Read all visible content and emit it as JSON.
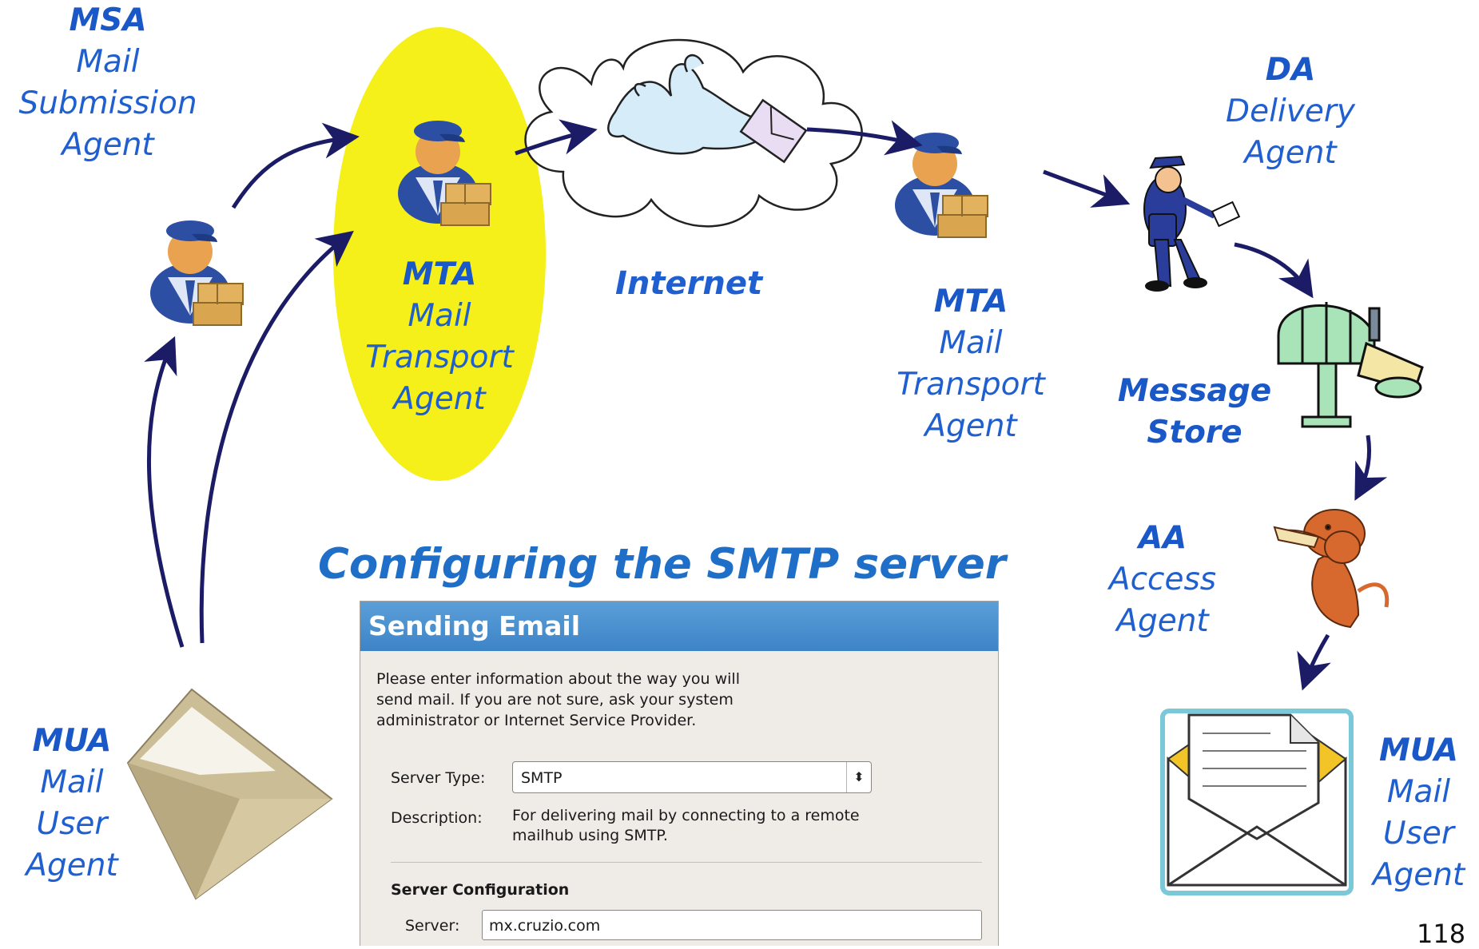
{
  "labels": {
    "msa": {
      "abbr": "MSA",
      "lines": [
        "Mail",
        "Submission",
        "Agent"
      ]
    },
    "mta1": {
      "abbr": "MTA",
      "lines": [
        "Mail",
        "Transport",
        "Agent"
      ]
    },
    "internet": "Internet",
    "mta2": {
      "abbr": "MTA",
      "lines": [
        "Mail",
        "Transport",
        "Agent"
      ]
    },
    "da": {
      "abbr": "DA",
      "lines": [
        "Delivery",
        "Agent"
      ]
    },
    "store": {
      "lines": [
        "Message",
        "Store"
      ]
    },
    "aa": {
      "abbr": "AA",
      "lines": [
        "Access",
        "Agent"
      ]
    },
    "mua1": {
      "abbr": "MUA",
      "lines": [
        "Mail",
        "User",
        "Agent"
      ]
    },
    "mua2": {
      "abbr": "MUA",
      "lines": [
        "Mail",
        "User",
        "Agent"
      ]
    }
  },
  "config_title": "Configuring the SMTP server",
  "page_number": "118",
  "dialog": {
    "title": "Sending Email",
    "intro_lines": [
      "Please enter information about the way you will",
      "send mail. If you are not sure, ask your system",
      "administrator or Internet Service Provider."
    ],
    "server_type_label": "Server Type:",
    "server_type_value": "SMTP",
    "description_label": "Description:",
    "description_lines": [
      "For delivering mail by connecting to a remote",
      "mailhub using SMTP."
    ],
    "section_title": "Server Configuration",
    "server_label": "Server:",
    "server_value": "mx.cruzio.com"
  },
  "colors": {
    "label_blue": "#1f5fd0",
    "highlight_yellow": "#f5ef1a",
    "arrow_navy": "#1c1c66",
    "dialog_header_blue": "#4a91cf"
  },
  "icons": [
    "worker-icon",
    "cloud-icon",
    "dove-icon",
    "mailman-icon",
    "mailbox-icon",
    "dog-icon",
    "envelope-icon",
    "letter-icon"
  ]
}
